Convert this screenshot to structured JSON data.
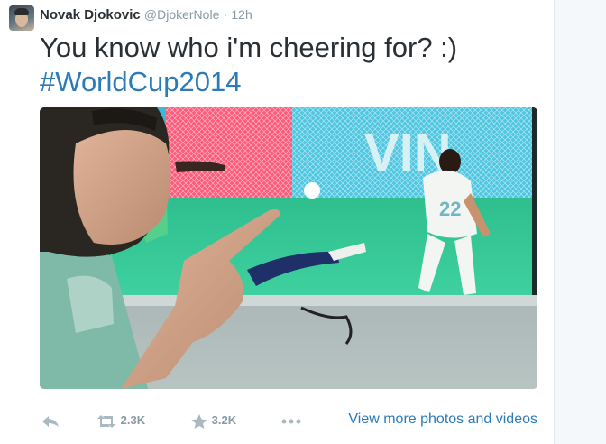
{
  "tweet": {
    "author": {
      "fullname": "Novak Djokovic",
      "username": "@DjokerNole"
    },
    "separator": "·",
    "timestamp": "12h",
    "text": "You know who i'm cheering for? :)",
    "hashtag": "#WorldCup2014",
    "media": {
      "jersey_number": "22",
      "banner_text": "VIN"
    },
    "actions": {
      "reply_icon": "reply-icon",
      "retweet_icon": "retweet-icon",
      "retweet_count": "2.3K",
      "favorite_icon": "star-icon",
      "favorite_count": "3.2K",
      "more_icon": "ellipsis-icon",
      "view_more": "View more photos and videos"
    }
  },
  "colors": {
    "link": "#2b7bb9",
    "muted": "#8899a6",
    "text": "#292f33",
    "gutter": "#f5f8fa"
  }
}
